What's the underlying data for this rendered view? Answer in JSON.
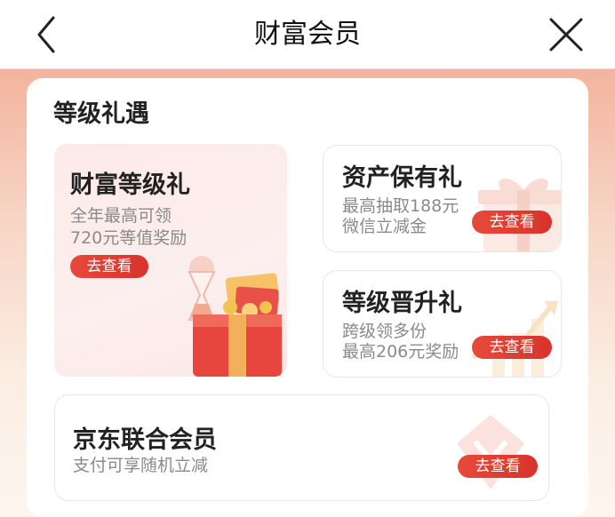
{
  "header": {
    "title": "财富会员"
  },
  "section": {
    "title": "等级礼遇"
  },
  "cards": {
    "wealth_level": {
      "title": "财富等级礼",
      "desc_line1": "全年最高可领",
      "desc_line2": "720元等值奖励",
      "button": "去查看"
    },
    "asset_holding": {
      "title": "资产保有礼",
      "desc_line1": "最高抽取188元",
      "desc_line2": "微信立减金",
      "button": "去查看"
    },
    "level_upgrade": {
      "title": "等级晋升礼",
      "desc_line1": "跨级领多份",
      "desc_line2": "最高206元奖励",
      "button": "去查看"
    },
    "jd_joint": {
      "title": "京东联合会员",
      "desc": "支付可享随机立减",
      "button": "去查看"
    }
  },
  "colors": {
    "accent": "#dd3b2f",
    "background_top": "#f3b49e"
  },
  "icons": [
    "back-arrow-icon",
    "close-icon",
    "treasure-chest-icon",
    "gift-box-icon",
    "growth-chart-icon",
    "jd-logo-icon"
  ]
}
